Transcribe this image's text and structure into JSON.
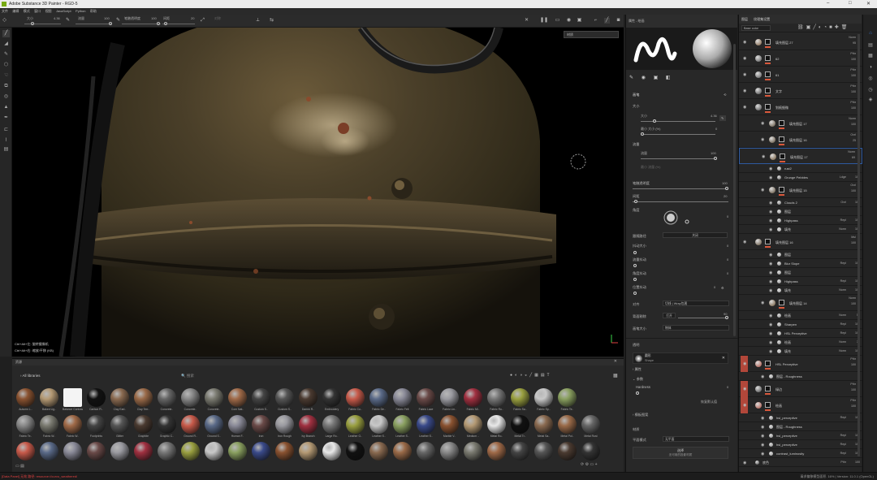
{
  "window": {
    "title": "Adobe Substance 3D Painter - RGD-5",
    "controls": [
      "–",
      "□",
      "✕"
    ]
  },
  "menu": [
    "文件",
    "编辑",
    "模式",
    "窗口",
    "视图",
    "JavaScript",
    "Python",
    "帮助"
  ],
  "toolbar": {
    "size_label": "大小",
    "size_value": "4.36",
    "flow_label": "流量",
    "flow_value": "100",
    "opacity_label": "笔触透明度",
    "opacity_value": "100",
    "spacing_label": "间距",
    "spacing_value": "20",
    "symmetry_label": "对称"
  },
  "viewport": {
    "mode_select": "材质",
    "hint1": "Ctrl+Alt+左: 旋转摄像机",
    "hint2": "Ctrl+Alt+右: 缩放/平移 (KB)"
  },
  "shelf": {
    "title": "资源",
    "filter": "All libraries",
    "search_placeholder": "搜索",
    "row1": [
      "Autumn L..",
      "Baked Lig..",
      "Balance Contrast",
      "Carbon Fi..",
      "Clay Earl..",
      "Clay Terr..",
      "Concrete..",
      "Concrete..",
      "Concrete..",
      "Corn Nat..",
      "Custom S..",
      "Custom S..",
      "Damm R..",
      "Embroidery",
      "Fabric Co..",
      "Fabric De..",
      "Fabric Felt",
      "Fabric Lace",
      "Fabric Lin..",
      "Fabric Mi..",
      "Fabric Ro..",
      "Fabric Sa..",
      "Fabric Sp..",
      "Fabric Te.."
    ],
    "row2": [
      "Fabric Te..",
      "Fabric W..",
      "Fabric W..",
      "Footprints",
      "Glitter",
      "Graphite",
      "Graphic C..",
      "Ground R..",
      "Ground S..",
      "Human F..",
      "Iron",
      "Iron Rough",
      "Ivy Branch",
      "Large Ro..",
      "Leather G..",
      "Leather S..",
      "Leather S..",
      "Leather S..",
      "Marble V..",
      "Medium ..",
      "Metal Ro..",
      "Metal Tr..",
      "Metal Sa..",
      "Metal Pol..",
      "Metal Rust"
    ],
    "row3": [
      "",
      "",
      "",
      "",
      "",
      "",
      "",
      "",
      "",
      "",
      "",
      "",
      "",
      "",
      "",
      "",
      "",
      "",
      "",
      "",
      "",
      "",
      "",
      "",
      ""
    ]
  },
  "properties": {
    "tabs": "属性 - 绘画",
    "section_brush": "画笔",
    "size_label": "大小",
    "size_value": "4.36",
    "min_size_label": "最小 大小 (%)",
    "min_size_value": "0",
    "flow_label": "流量",
    "flow_value": "100",
    "min_flow_label": "最小 流量 (%)",
    "opacity_label": "笔触透明度",
    "opacity_value": "100",
    "spacing_label": "间距",
    "spacing_value": "20",
    "angle_label": "角度",
    "angle_value": "0",
    "follow_label": "跟随路径",
    "follow_value": "关闭",
    "jitter_size_label": "抖动大小",
    "jitter_size_value": "0",
    "jitter_flow_label": "流量抖动",
    "jitter_flow_value": "0",
    "jitter_angle_label": "角度抖动",
    "jitter_angle_value": "0",
    "jitter_pos_label": "位置抖动",
    "jitter_pos_value": "0",
    "alignment_label": "对齐",
    "alignment_value": "切线 | Wrap包裹",
    "backface_label": "背面剔除",
    "backface_value": "打开",
    "backface_angle": "90",
    "size_space_label": "画笔大小",
    "size_space_value": "物体",
    "section_alpha": "透明",
    "alpha_name": "圆形",
    "alpha_sub": "Shape",
    "attr_label": "属性",
    "params_label": "参数",
    "hardness_label": "Hardness",
    "hardness_value": "0",
    "reset_btn": "恢复默认值",
    "stencil_label": "模板图案",
    "material_label": "材质",
    "mat_mode_label": "平面模式",
    "mat_mode_value": "无平面",
    "select_btn": "选择",
    "select_sub": "无可用的投影材质"
  },
  "layers": {
    "tabs": [
      "图层",
      "纹理集设置"
    ],
    "channel_select": "Base color",
    "rows": [
      {
        "name": "填充图层 27",
        "blend": "Norm",
        "opacity": "95"
      },
      {
        "name": "62",
        "blend": "Pthr",
        "opacity": "100"
      },
      {
        "name": "61",
        "blend": "Pthr",
        "opacity": "100"
      },
      {
        "name": "文字",
        "blend": "Pthr",
        "opacity": "100"
      },
      {
        "name": "划痕细微",
        "blend": "Pthr",
        "opacity": "100"
      },
      {
        "name": "填充图层 17",
        "blend": "Norm",
        "opacity": "100"
      },
      {
        "name": "填充图层 16",
        "blend": "Ovrl",
        "opacity": "25"
      },
      {
        "name": "填充图层 17",
        "blend": "Norm",
        "opacity": "69"
      },
      {
        "name": "rust2",
        "blend": "",
        "opacity": ""
      },
      {
        "name": "Grunge Pebbles",
        "blend": "Ldge",
        "opacity": "100"
      },
      {
        "name": "填充图层 15",
        "blend": "Ovrl",
        "opacity": "100"
      },
      {
        "name": "Clouds 2",
        "blend": "Ovrl",
        "opacity": "100"
      },
      {
        "name": "图层",
        "blend": "",
        "opacity": ""
      },
      {
        "name": "Highpass",
        "blend": "Repl",
        "opacity": "100"
      },
      {
        "name": "填充",
        "blend": "Norm",
        "opacity": "100"
      },
      {
        "name": "填充图层 16",
        "blend": "Mul",
        "opacity": "100"
      },
      {
        "name": "图层",
        "blend": "",
        "opacity": ""
      },
      {
        "name": "Blur Slope",
        "blend": "Repl",
        "opacity": "100"
      },
      {
        "name": "图层",
        "blend": "",
        "opacity": ""
      },
      {
        "name": "Highpass",
        "blend": "Repl",
        "opacity": "100"
      },
      {
        "name": "填充",
        "blend": "Norm",
        "opacity": "100"
      },
      {
        "name": "填充图层 14",
        "blend": "Norm",
        "opacity": "100"
      },
      {
        "name": "绘画",
        "blend": "Norm",
        "opacity": "54"
      },
      {
        "name": "Sharpen",
        "blend": "Repl",
        "opacity": "100"
      },
      {
        "name": "HSL Perceptive",
        "blend": "Repl",
        "opacity": "100"
      },
      {
        "name": "绘画",
        "blend": "Norm",
        "opacity": "37"
      },
      {
        "name": "填充",
        "blend": "Norm",
        "opacity": "100"
      },
      {
        "name": "HSL Perceptive",
        "blend": "Pthr",
        "opacity": "100"
      },
      {
        "name": "图层 - Roughness",
        "blend": "",
        "opacity": ""
      },
      {
        "name": "绿边",
        "blend": "Pthr",
        "opacity": "100"
      },
      {
        "name": "绘画",
        "blend": "Pthr",
        "opacity": "100"
      },
      {
        "name": "hsl_perceptive",
        "blend": "Repl",
        "opacity": "100"
      },
      {
        "name": "图层 - Roughness",
        "blend": "",
        "opacity": ""
      },
      {
        "name": "hsl_perceptive",
        "blend": "Repl",
        "opacity": "100"
      },
      {
        "name": "hsl_perceptive",
        "blend": "Repl",
        "opacity": "100"
      },
      {
        "name": "contrast_luminosity",
        "blend": "Repl",
        "opacity": "100"
      },
      {
        "name": "底色",
        "blend": "Pthr",
        "opacity": "100"
      }
    ]
  },
  "status": {
    "left": "[Data Panel] 无效 路径: resource://curvo_weathered/",
    "right": "请求偏移模型面积.   16% | Version: 11.0.1 (OpenGL)"
  },
  "colors": {
    "accent": "#d9583b",
    "selection": "#2e5aa0",
    "active_icon": "#3a7bd5"
  }
}
